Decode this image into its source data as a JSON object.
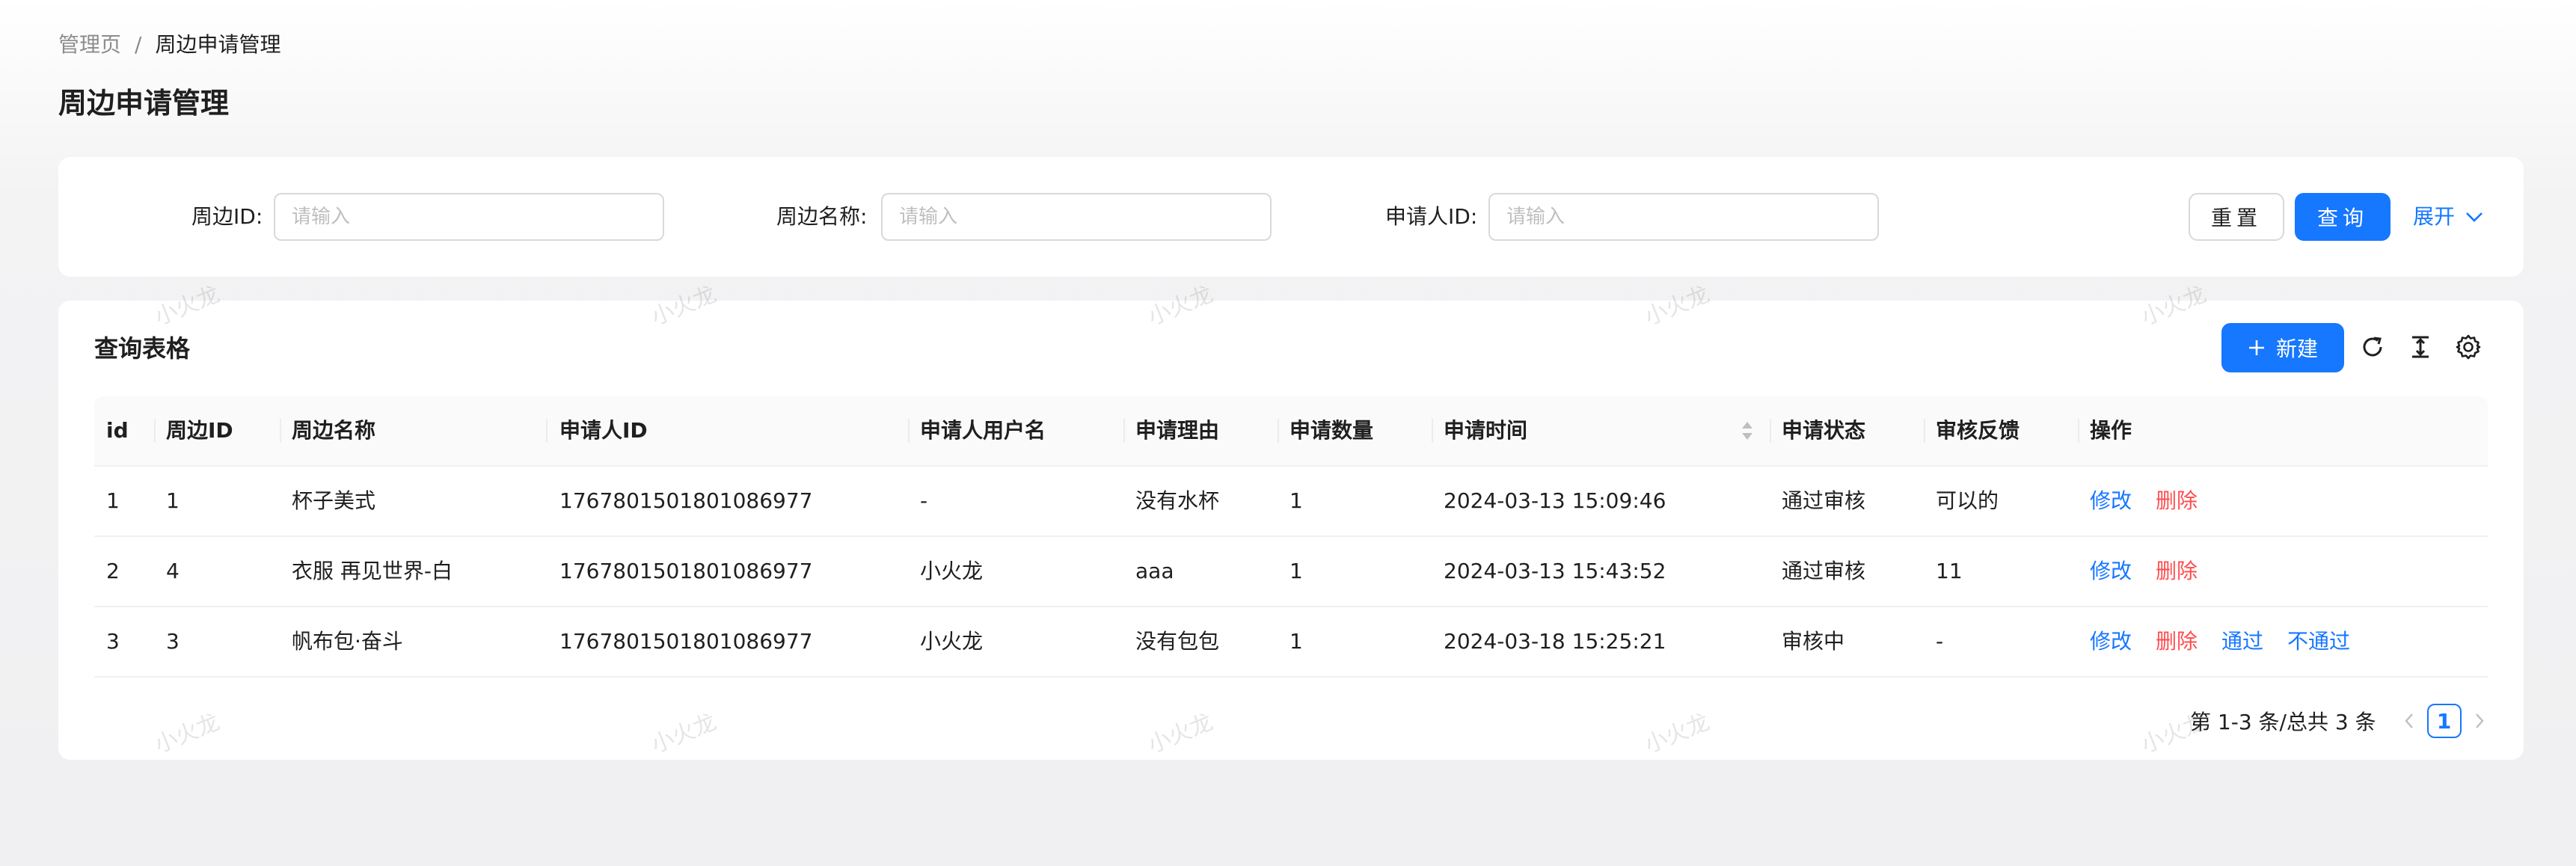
{
  "breadcrumb": {
    "home": "管理页",
    "separator": "/",
    "current": "周边申请管理"
  },
  "page_title": "周边申请管理",
  "search": {
    "fields": [
      {
        "label": "周边ID",
        "placeholder": "请输入"
      },
      {
        "label": "周边名称",
        "placeholder": "请输入"
      },
      {
        "label": "申请人ID",
        "placeholder": "请输入"
      }
    ],
    "colon": ":",
    "reset_label": "重置",
    "query_label": "查询",
    "expand_label": "展开"
  },
  "table_card": {
    "title": "查询表格",
    "new_label": "新建"
  },
  "table": {
    "columns": [
      "id",
      "周边ID",
      "周边名称",
      "申请人ID",
      "申请人用户名",
      "申请理由",
      "申请数量",
      "申请时间",
      "申请状态",
      "审核反馈",
      "操作"
    ],
    "rows": [
      {
        "id": "1",
        "peripheral_id": "1",
        "name": "杯子美式",
        "applicant_id": "1767801501801086977",
        "username": "-",
        "reason": "没有水杯",
        "quantity": "1",
        "time": "2024-03-13 15:09:46",
        "status": "通过审核",
        "feedback": "可以的",
        "actions": [
          "修改",
          "删除"
        ]
      },
      {
        "id": "2",
        "peripheral_id": "4",
        "name": "衣服 再见世界-白",
        "applicant_id": "1767801501801086977",
        "username": "小火龙",
        "reason": "aaa",
        "quantity": "1",
        "time": "2024-03-13 15:43:52",
        "status": "通过审核",
        "feedback": "11",
        "actions": [
          "修改",
          "删除"
        ]
      },
      {
        "id": "3",
        "peripheral_id": "3",
        "name": "帆布包·奋斗",
        "applicant_id": "1767801501801086977",
        "username": "小火龙",
        "reason": "没有包包",
        "quantity": "1",
        "time": "2024-03-18 15:25:21",
        "status": "审核中",
        "feedback": "-",
        "actions": [
          "修改",
          "删除",
          "通过",
          "不通过"
        ]
      }
    ]
  },
  "pagination": {
    "total_text": "第 1-3 条/总共 3 条",
    "current_page": "1"
  },
  "watermark_text": "小火龙",
  "colors": {
    "primary": "#1677ff",
    "danger": "#ff4d4f",
    "border": "#d9d9d9",
    "header_bg": "#fafafa"
  }
}
